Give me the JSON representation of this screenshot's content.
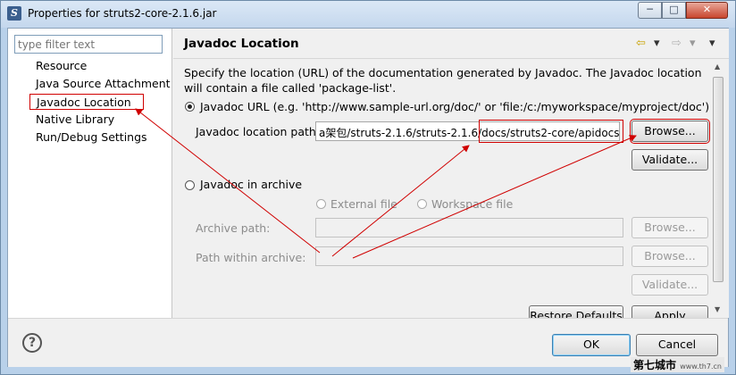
{
  "window": {
    "title": "Properties for struts2-core-2.1.6.jar",
    "minimize_icon": "minimize-icon",
    "maximize_icon": "maximize-icon",
    "close_icon": "close-icon",
    "min_glyph": "─",
    "max_glyph": "□",
    "close_glyph": "✕"
  },
  "sidebar": {
    "filter_placeholder": "type filter text",
    "items": [
      {
        "label": "Resource"
      },
      {
        "label": "Java Source Attachment"
      },
      {
        "label": "Javadoc Location",
        "selected": true
      },
      {
        "label": "Native Library"
      },
      {
        "label": "Run/Debug Settings"
      }
    ]
  },
  "page": {
    "title": "Javadoc Location",
    "back_glyph": "⇦",
    "forward_glyph": "⇨",
    "dropdown_glyph": "▾",
    "description": "Specify the location (URL) of the documentation generated by Javadoc. The Javadoc location will contain a file called 'package-list'.",
    "url_radio_label": "Javadoc URL (e.g. 'http://www.sample-url.org/doc/' or 'file:/c:/myworkspace/myproject/doc')",
    "location_path_label": "Javadoc location path:",
    "location_path_value": "a架包/struts-2.1.6/struts-2.1.6/docs/struts2-core/apidocs/",
    "browse_label": "Browse...",
    "validate_label": "Validate...",
    "archive_radio_label": "Javadoc in archive",
    "external_file_label": "External file",
    "workspace_file_label": "Workspace file",
    "archive_path_label": "Archive path:",
    "archive_browse_label": "Browse...",
    "path_within_label": "Path within archive:",
    "path_within_browse_label": "Browse...",
    "archive_validate_label": "Validate...",
    "restore_defaults_label": "Restore Defaults",
    "apply_label": "Apply"
  },
  "footer": {
    "help_glyph": "?",
    "ok_label": "OK",
    "cancel_label": "Cancel"
  },
  "watermark": {
    "text": "第七城市",
    "site": "www.th7.cn"
  },
  "colors": {
    "annotation_red": "#d00000"
  }
}
